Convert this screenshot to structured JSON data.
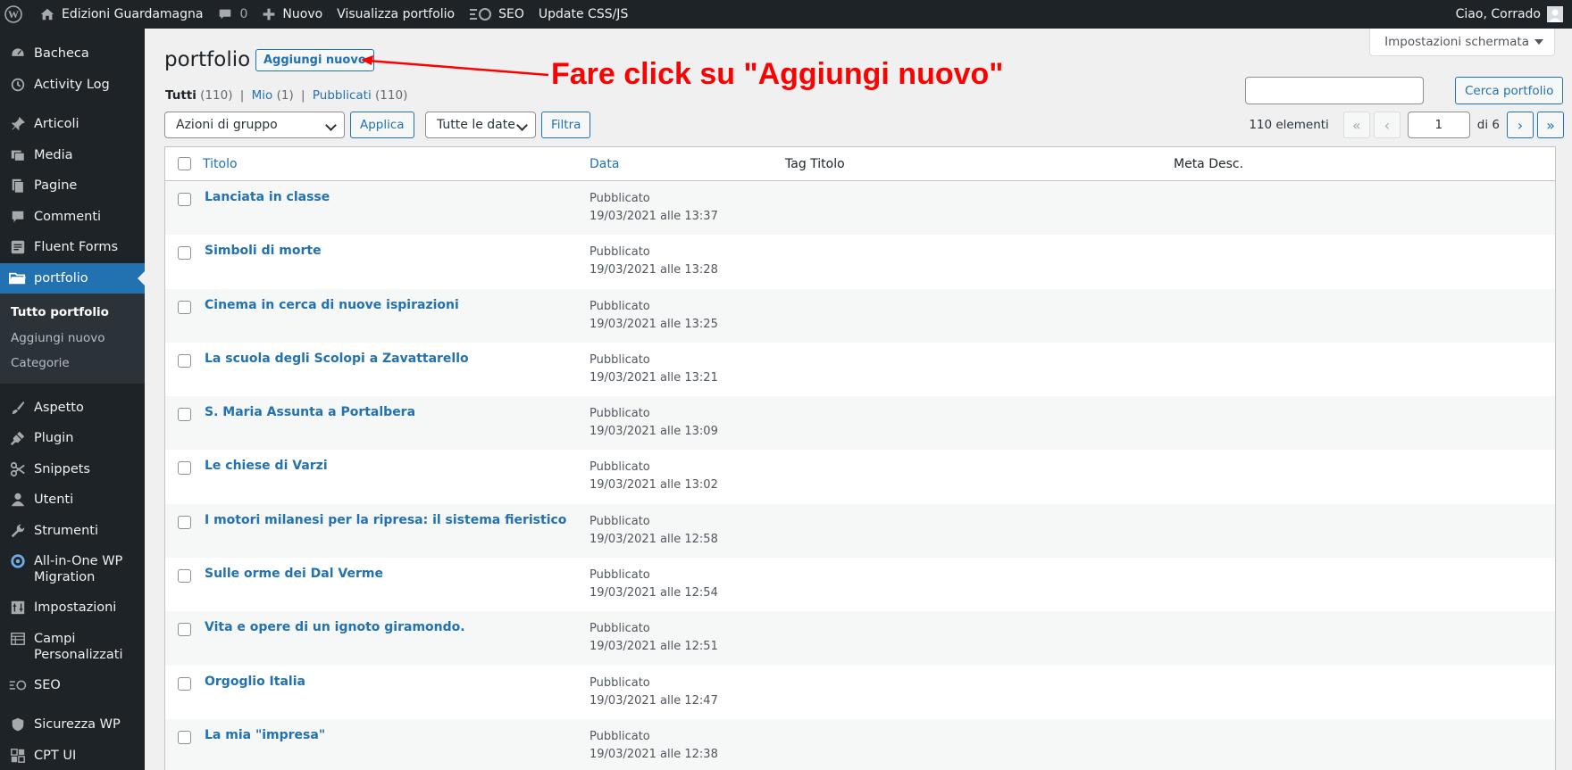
{
  "adminbar": {
    "site_name": "Edizioni Guardamagna",
    "comments_count": "0",
    "new_label": "Nuovo",
    "view_label": "Visualizza portfolio",
    "seo_label": "SEO",
    "update_css_label": "Update CSS/JS",
    "greeting": "Ciao, Corrado"
  },
  "sidebar": {
    "items": [
      {
        "label": "Bacheca",
        "icon": "dashboard-icon"
      },
      {
        "label": "Activity Log",
        "icon": "activity-log-icon"
      },
      {
        "label": "Articoli",
        "icon": "pin-icon"
      },
      {
        "label": "Media",
        "icon": "media-icon"
      },
      {
        "label": "Pagine",
        "icon": "pages-icon"
      },
      {
        "label": "Commenti",
        "icon": "comments-icon"
      },
      {
        "label": "Fluent Forms",
        "icon": "forms-icon"
      },
      {
        "label": "portfolio",
        "icon": "folder-icon"
      }
    ],
    "submenu": [
      "Tutto portfolio",
      "Aggiungi nuovo",
      "Categorie"
    ],
    "items2": [
      {
        "label": "Aspetto",
        "icon": "brush-icon"
      },
      {
        "label": "Plugin",
        "icon": "plugin-icon"
      },
      {
        "label": "Snippets",
        "icon": "scissors-icon"
      },
      {
        "label": "Utenti",
        "icon": "user-icon"
      },
      {
        "label": "Strumenti",
        "icon": "wrench-icon"
      },
      {
        "label": "All-in-One WP Migration",
        "icon": "migration-icon"
      },
      {
        "label": "Impostazioni",
        "icon": "settings-icon"
      },
      {
        "label": "Campi Personalizzati",
        "icon": "fields-icon"
      },
      {
        "label": "SEO",
        "icon": "seo-icon"
      },
      {
        "label": "Sicurezza WP",
        "icon": "shield-icon"
      },
      {
        "label": "CPT UI",
        "icon": "cpt-icon"
      }
    ]
  },
  "header": {
    "screen_options": "Impostazioni schermata",
    "title": "portfolio",
    "add_new": "Aggiungi nuovo",
    "annotation": "Fare click su \"Aggiungi nuovo\""
  },
  "filters": {
    "all_label": "Tutti",
    "all_count": "(110)",
    "mine_label": "Mio",
    "mine_count": "(1)",
    "published_label": "Pubblicati",
    "published_count": "(110)",
    "separator": "|",
    "bulk_action": "Azioni di gruppo",
    "apply": "Applica",
    "dates": "Tutte le date",
    "filter": "Filtra",
    "search_button": "Cerca portfolio",
    "search_value": ""
  },
  "pagination": {
    "count": "110 elementi",
    "first": "«",
    "prev": "‹",
    "current": "1",
    "of": "di 6",
    "next": "›",
    "last": "»"
  },
  "table": {
    "columns": [
      "Titolo",
      "Data",
      "Tag Titolo",
      "Meta Desc."
    ],
    "rows": [
      {
        "title": "Lanciata in classe",
        "status": "Pubblicato",
        "date": "19/03/2021 alle 13:37"
      },
      {
        "title": "Simboli di morte",
        "status": "Pubblicato",
        "date": "19/03/2021 alle 13:28"
      },
      {
        "title": "Cinema in cerca di nuove ispirazioni",
        "status": "Pubblicato",
        "date": "19/03/2021 alle 13:25"
      },
      {
        "title": "La scuola degli Scolopi a Zavattarello",
        "status": "Pubblicato",
        "date": "19/03/2021 alle 13:21"
      },
      {
        "title": "S. Maria Assunta a Portalbera",
        "status": "Pubblicato",
        "date": "19/03/2021 alle 13:09"
      },
      {
        "title": "Le chiese di Varzi",
        "status": "Pubblicato",
        "date": "19/03/2021 alle 13:02"
      },
      {
        "title": "I motori milanesi per la ripresa: il sistema fieristico",
        "status": "Pubblicato",
        "date": "19/03/2021 alle 12:58"
      },
      {
        "title": "Sulle orme dei Dal Verme",
        "status": "Pubblicato",
        "date": "19/03/2021 alle 12:54"
      },
      {
        "title": "Vita e opere di un ignoto giramondo.",
        "status": "Pubblicato",
        "date": "19/03/2021 alle 12:51"
      },
      {
        "title": "Orgoglio Italia",
        "status": "Pubblicato",
        "date": "19/03/2021 alle 12:47"
      },
      {
        "title": "La mia \"impresa\"",
        "status": "Pubblicato",
        "date": "19/03/2021 alle 12:38"
      }
    ]
  },
  "colors": {
    "accent": "#2271b1",
    "annotation": "#ff0000",
    "sidebar_bg": "#1d2327"
  }
}
